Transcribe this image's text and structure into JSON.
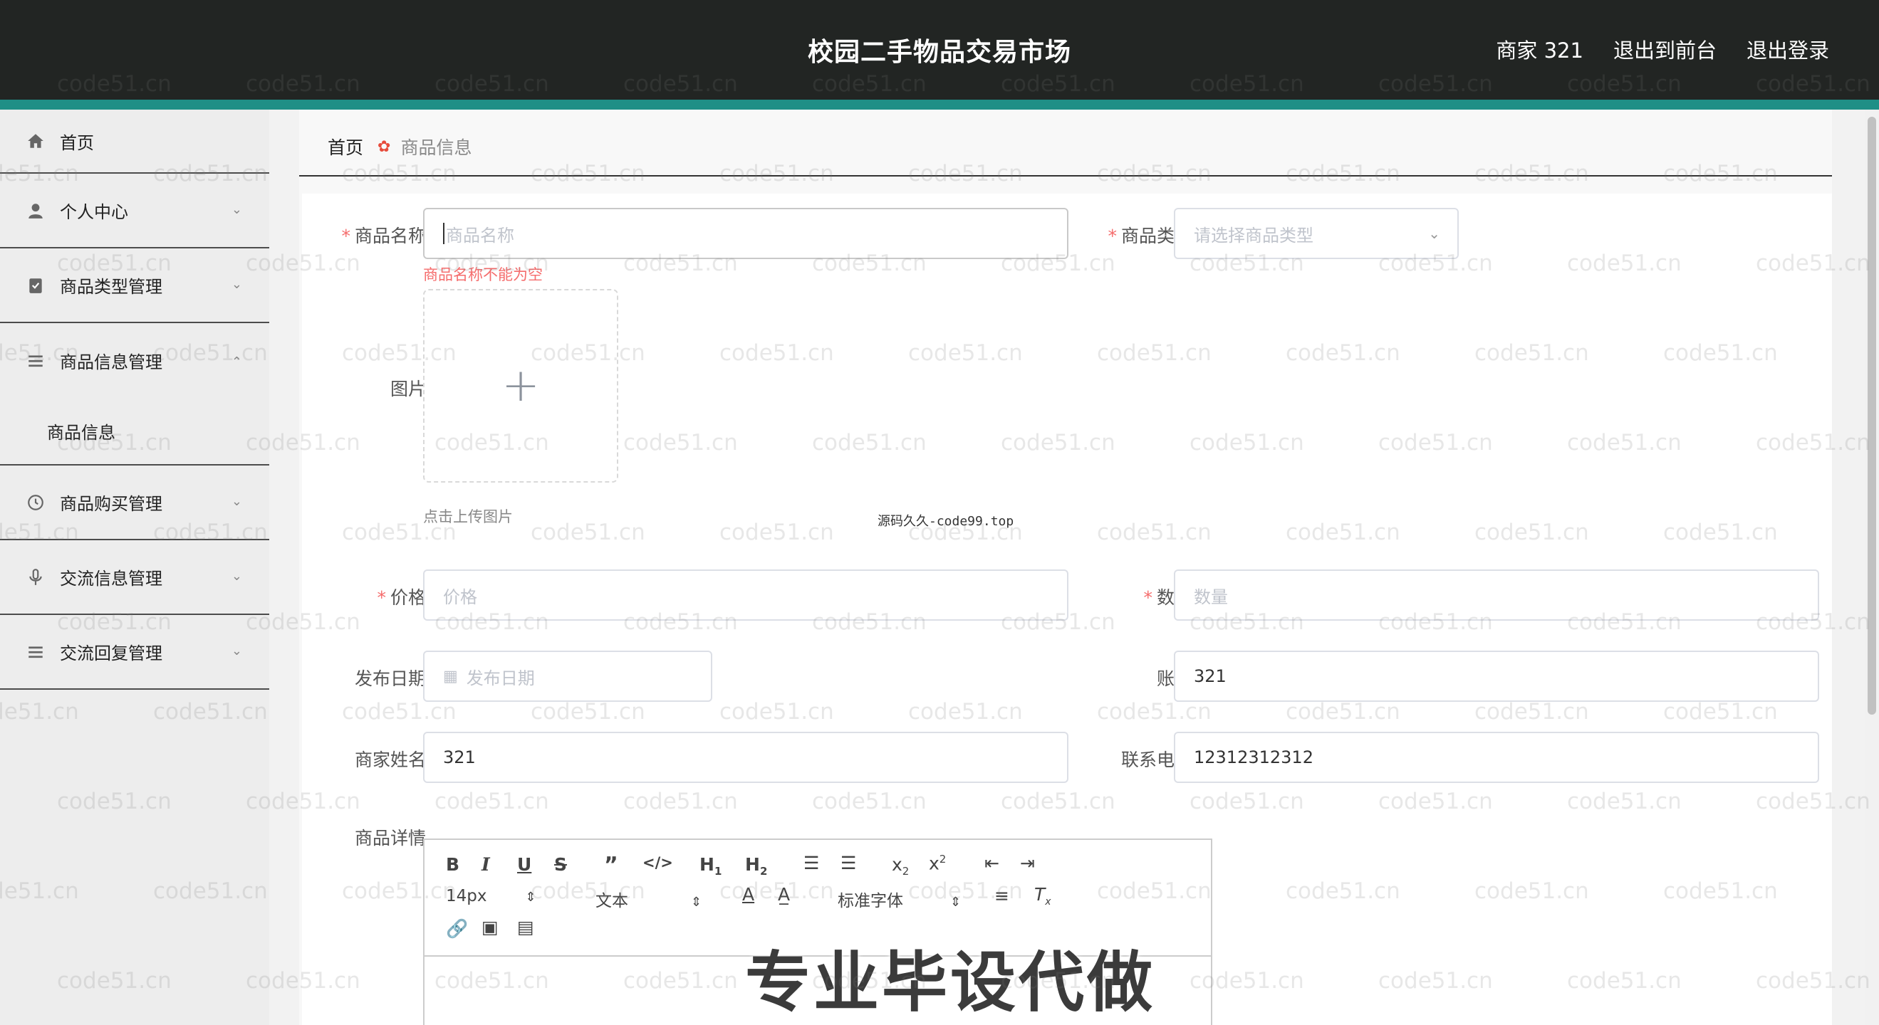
{
  "header": {
    "title": "校园二手物品交易市场",
    "nav": [
      "商家 321",
      "退出到前台",
      "退出登录"
    ]
  },
  "sidebar": {
    "items": [
      {
        "label": "首页",
        "icon": "home-icon"
      },
      {
        "label": "个人中心",
        "icon": "user-icon"
      },
      {
        "label": "商品类型管理",
        "icon": "clipboard-icon"
      },
      {
        "label": "商品信息管理",
        "icon": "list-icon",
        "expanded": true
      },
      {
        "label": "商品购买管理",
        "icon": "clock-icon"
      },
      {
        "label": "交流信息管理",
        "icon": "microphone-icon"
      },
      {
        "label": "交流回复管理",
        "icon": "list-icon"
      }
    ],
    "submenu": "商品信息"
  },
  "breadcrumb": {
    "home": "首页",
    "current": "商品信息"
  },
  "form": {
    "name_label": "商品名称",
    "name_placeholder": "商品名称",
    "name_error": "商品名称不能为空",
    "type_label": "商品类型",
    "type_placeholder": "请选择商品类型",
    "image_label": "图片",
    "upload_hint": "点击上传图片",
    "price_label": "价格",
    "price_placeholder": "价格",
    "qty_label": "数量",
    "qty_placeholder": "数量",
    "date_label": "发布日期",
    "date_placeholder": "发布日期",
    "account_label": "账号",
    "account_value": "321",
    "merchant_label": "商家姓名",
    "merchant_value": "321",
    "phone_label": "联系电话",
    "phone_value": "12312312312",
    "detail_label": "商品详情"
  },
  "editor": {
    "font_size": "14px",
    "block_type": "文本",
    "font_family": "标准字体"
  },
  "overlay": {
    "center_text": "源码久久-code99.top",
    "promo": "专业毕设代做",
    "watermark": "code51.cn"
  },
  "colors": {
    "header": "#222523",
    "accent": "#1f8f86",
    "required": "#f56c6c"
  }
}
